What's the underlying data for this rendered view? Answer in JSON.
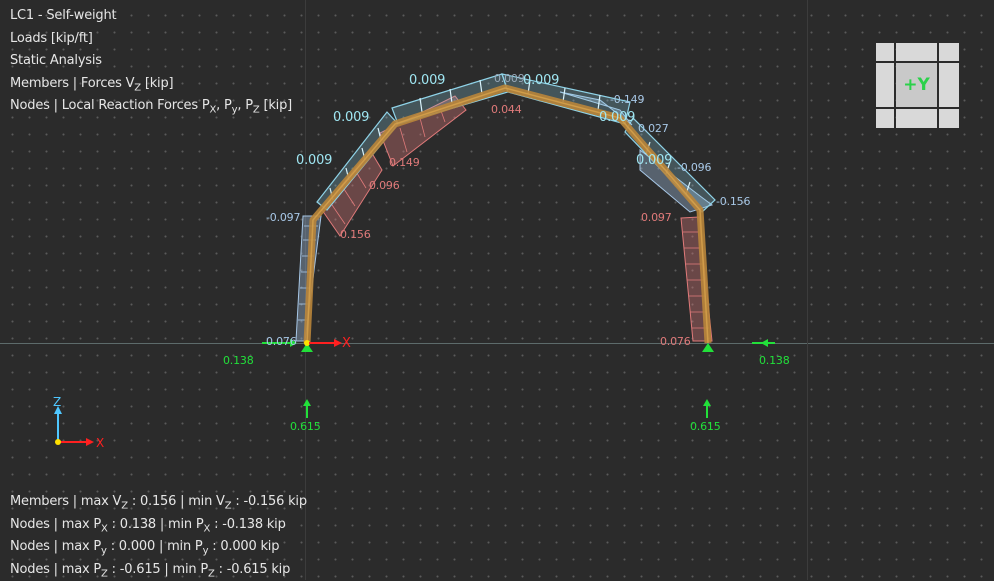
{
  "info": {
    "load_case": "LC1 - Self-weight",
    "loads_unit": "Loads [kip/ft]",
    "analysis": "Static Analysis",
    "members_label": "Members | Forces V",
    "members_sub": "Z",
    "members_unit": " [kip]",
    "nodes_label": "Nodes | Local Reaction Forces P",
    "nodes_sub_x": "X",
    "nodes_sub_y": "y",
    "nodes_sub_z": "Z",
    "nodes_unit": " [kip]"
  },
  "summary": {
    "line1_a": "Members | max V",
    "line1_sub1": "Z",
    "line1_b": " : 0.156 | min V",
    "line1_sub2": "Z",
    "line1_c": " : -0.156 kip",
    "line2_a": "Nodes | max P",
    "line2_sub1": "X",
    "line2_b": " : 0.138 | min P",
    "line2_sub2": "X",
    "line2_c": " : -0.138 kip",
    "line3_a": "Nodes | max P",
    "line3_sub1": "y",
    "line3_b": " : 0.000 | min P",
    "line3_sub2": "y",
    "line3_c": " : 0.000 kip",
    "line4_a": "Nodes | max P",
    "line4_sub1": "Z",
    "line4_b": " : -0.615 | min P",
    "line4_sub2": "Z",
    "line4_c": " : -0.615 kip"
  },
  "navcube": {
    "label": "+Y"
  },
  "axes": {
    "global_x": "X",
    "global_z": "Z",
    "local_x": "X"
  },
  "load_labels": {
    "l1": "0.009",
    "l2": "0.009",
    "l3": "0.009",
    "l4": "0.009",
    "l5": "0.009",
    "l6": "0.009",
    "l7": "0.009",
    "l8": "0.044"
  },
  "shear_labels": {
    "left_col_top": "-0.097",
    "left_col_bot": "0.076",
    "left_r1_end": "0.156",
    "left_r2": "0.096",
    "left_r3": "0.149",
    "apex": "0.044",
    "right_r3": "-0.149",
    "right_r2": "-0.096",
    "right_r2b": "0.027",
    "right_r1_end": "-0.156",
    "right_col_top": "0.097",
    "right_col_bot": "0.076"
  },
  "reactions": {
    "left_px": "0.138",
    "left_pz": "0.615",
    "right_px": "0.138",
    "right_pz": "0.615"
  },
  "colors": {
    "member": "#b9853a",
    "load": "#8fd3e8",
    "shear_pos": "#e07a7a",
    "shear_neg": "#a7c7e6",
    "reaction": "#22e03a",
    "axis_x": "#ff2020",
    "axis_z": "#4fc7ff"
  }
}
